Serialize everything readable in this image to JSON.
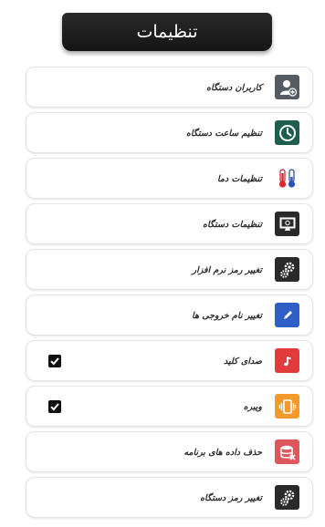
{
  "header": {
    "title": "تنظیمات"
  },
  "items": [
    {
      "label": "کاربران دستگاه"
    },
    {
      "label": "تنظیم ساعت دستگاه"
    },
    {
      "label": "تنظیمات دما"
    },
    {
      "label": "تنظیمات دستگاه"
    },
    {
      "label": "تغییر رمز نرم افزار"
    },
    {
      "label": "تغییر نام خروجی ها"
    },
    {
      "label": "صدای کلید",
      "checked": true
    },
    {
      "label": "ویبره",
      "checked": true
    },
    {
      "label": "حذف داده های برنامه"
    },
    {
      "label": "تغییر رمز دستگاه"
    }
  ],
  "icons": {
    "users": "user-add-icon",
    "clock": "clock-icon",
    "temperature": "thermometer-icon",
    "device": "monitor-icon",
    "app_password": "gear-lock-icon",
    "rename": "pencil-icon",
    "sound": "music-note-icon",
    "vibrate": "vibrate-icon",
    "delete_data": "database-delete-icon",
    "device_password": "gear-lock-icon"
  },
  "colors": {
    "banner": "#1e1e1e",
    "clock": "#1d5e4e",
    "rename": "#2f5ec4",
    "sound": "#e23b3b",
    "vibrate": "#f39a2b",
    "delete_data": "#e0575b"
  }
}
